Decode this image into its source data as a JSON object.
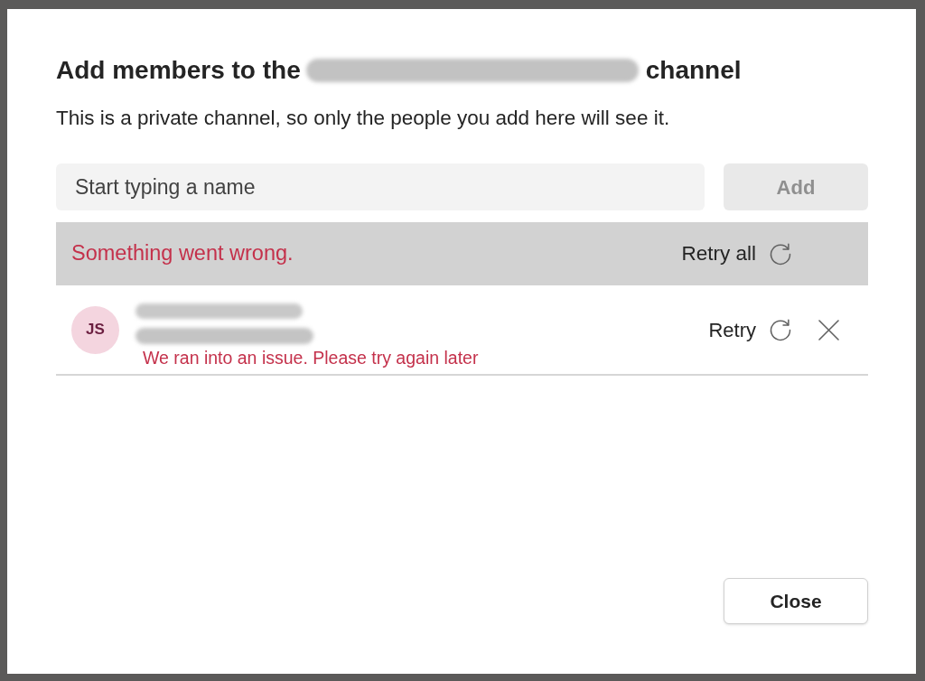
{
  "dialog": {
    "title_before": "Add members to the",
    "title_after": "channel",
    "subtitle": "This is a private channel, so only the people you add here will see it.",
    "search": {
      "placeholder": "Start typing a name"
    },
    "add_button": {
      "label": "Add",
      "disabled": true
    },
    "error_banner": {
      "message": "Something went wrong.",
      "action": "Retry all"
    },
    "members": [
      {
        "initials": "JS",
        "color": "#f4d5df",
        "error": "We ran into an issue. Please try again later",
        "action": "Retry"
      }
    ],
    "close_button": {
      "label": "Close"
    }
  }
}
